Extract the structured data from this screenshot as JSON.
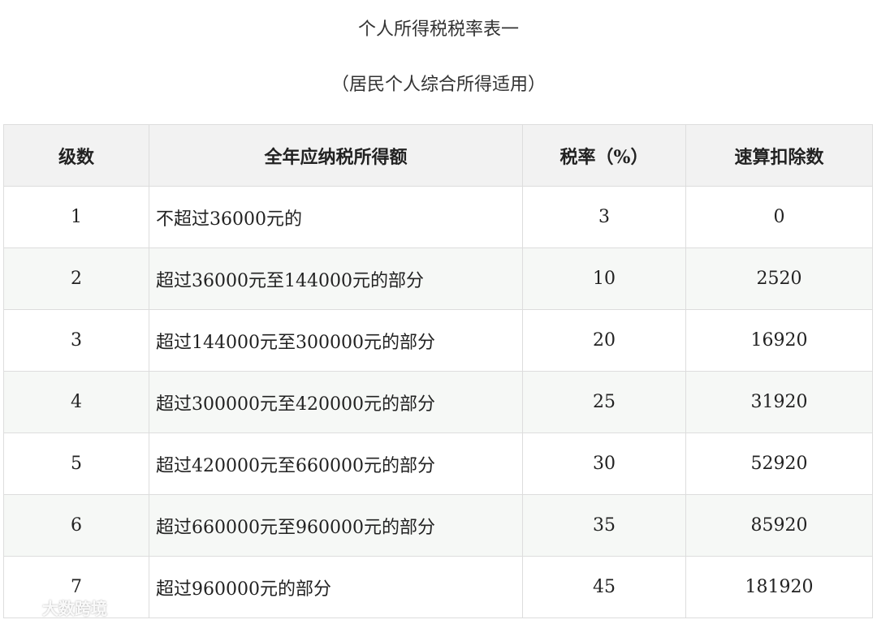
{
  "title": "个人所得税税率表一",
  "subtitle": "（居民个人综合所得适用）",
  "table": {
    "headers": [
      "级数",
      "全年应纳税所得额",
      "税率（%）",
      "速算扣除数"
    ],
    "rows": [
      {
        "level": "1",
        "range": "不超过36000元的",
        "rate": "3",
        "deduction": "0"
      },
      {
        "level": "2",
        "range": "超过36000元至144000元的部分",
        "rate": "10",
        "deduction": "2520"
      },
      {
        "level": "3",
        "range": "超过144000元至300000元的部分",
        "rate": "20",
        "deduction": "16920"
      },
      {
        "level": "4",
        "range": "超过300000元至420000元的部分",
        "rate": "25",
        "deduction": "31920"
      },
      {
        "level": "5",
        "range": "超过420000元至660000元的部分",
        "rate": "30",
        "deduction": "52920"
      },
      {
        "level": "6",
        "range": "超过660000元至960000元的部分",
        "rate": "35",
        "deduction": "85920"
      },
      {
        "level": "7",
        "range": "超过960000元的部分",
        "rate": "45",
        "deduction": "181920"
      }
    ]
  },
  "watermark": {
    "icon": "brand-logo-icon",
    "text": "大数跨境"
  }
}
